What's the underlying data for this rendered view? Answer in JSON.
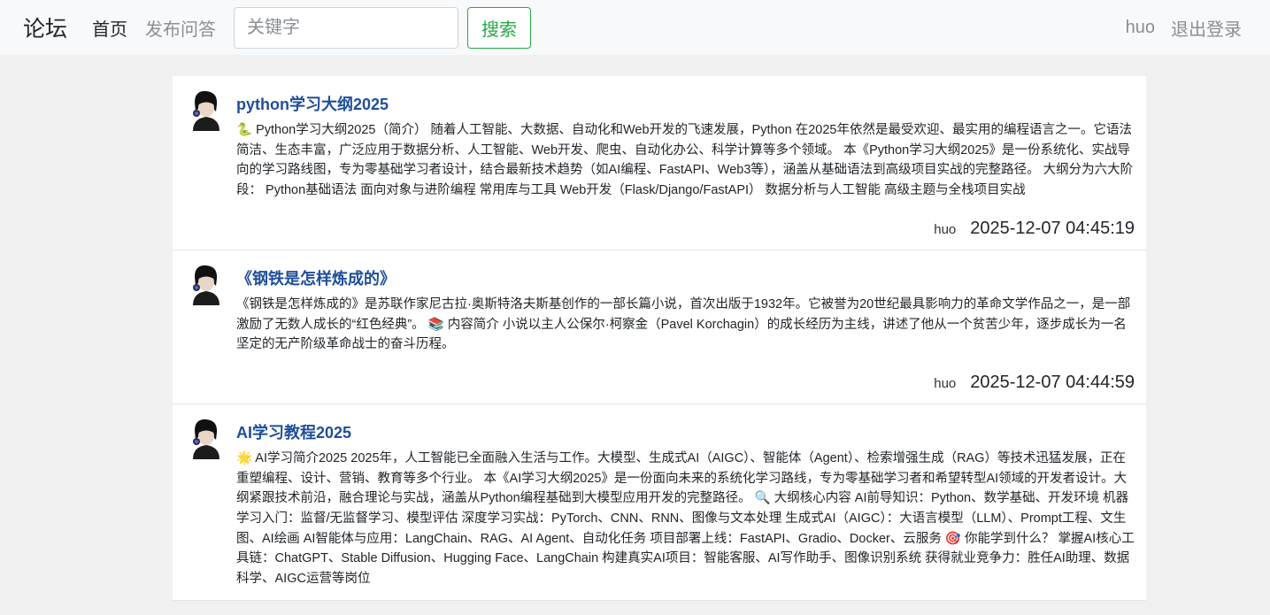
{
  "navbar": {
    "brand": "论坛",
    "links": [
      {
        "label": "首页"
      },
      {
        "label": "发布问答"
      }
    ],
    "search": {
      "placeholder": "关键字",
      "button": "搜索"
    },
    "user": "huo",
    "logout": "退出登录"
  },
  "posts": [
    {
      "title": "python学习大纲2025",
      "content": "🐍 Python学习大纲2025（简介） 随着人工智能、大数据、自动化和Web开发的飞速发展，Python 在2025年依然是最受欢迎、最实用的编程语言之一。它语法简洁、生态丰富，广泛应用于数据分析、人工智能、Web开发、爬虫、自动化办公、科学计算等多个领域。 本《Python学习大纲2025》是一份系统化、实战导向的学习路线图，专为零基础学习者设计，结合最新技术趋势（如AI编程、FastAPI、Web3等），涵盖从基础语法到高级项目实战的完整路径。 大纲分为六大阶段： Python基础语法 面向对象与进阶编程 常用库与工具 Web开发（Flask/Django/FastAPI） 数据分析与人工智能 高级主题与全栈项目实战",
      "author": "huo",
      "time": "2025-12-07 04:45:19"
    },
    {
      "title": "《钢铁是怎样炼成的》",
      "content": "《钢铁是怎样炼成的》是苏联作家尼古拉·奥斯特洛夫斯基创作的一部长篇小说，首次出版于1932年。它被誉为20世纪最具影响力的革命文学作品之一，是一部激励了无数人成长的“红色经典”。 📚 内容简介 小说以主人公保尔·柯察金（Pavel Korchagin）的成长经历为主线，讲述了他从一个贫苦少年，逐步成长为一名坚定的无产阶级革命战士的奋斗历程。",
      "author": "huo",
      "time": "2025-12-07 04:44:59"
    },
    {
      "title": "AI学习教程2025",
      "content": "🌟 AI学习简介2025 2025年，人工智能已全面融入生活与工作。大模型、生成式AI（AIGC）、智能体（Agent）、检索增强生成（RAG）等技术迅猛发展，正在重塑编程、设计、营销、教育等多个行业。 本《AI学习大纲2025》是一份面向未来的系统化学习路线，专为零基础学习者和希望转型AI领域的开发者设计。大纲紧跟技术前沿，融合理论与实战，涵盖从Python编程基础到大模型应用开发的完整路径。 🔍 大纲核心内容 AI前导知识：Python、数学基础、开发环境 机器学习入门：监督/无监督学习、模型评估 深度学习实战：PyTorch、CNN、RNN、图像与文本处理 生成式AI（AIGC）：大语言模型（LLM）、Prompt工程、文生图、AI绘画 AI智能体与应用：LangChain、RAG、AI Agent、自动化任务 项目部署上线：FastAPI、Gradio、Docker、云服务 🎯 你能学到什么？ 掌握AI核心工具链：ChatGPT、Stable Diffusion、Hugging Face、LangChain 构建真实AI项目：智能客服、AI写作助手、图像识别系统 获得就业竞争力：胜任AI助理、数据科学、AIGC运营等岗位",
      "author": "huo",
      "time": ""
    }
  ]
}
